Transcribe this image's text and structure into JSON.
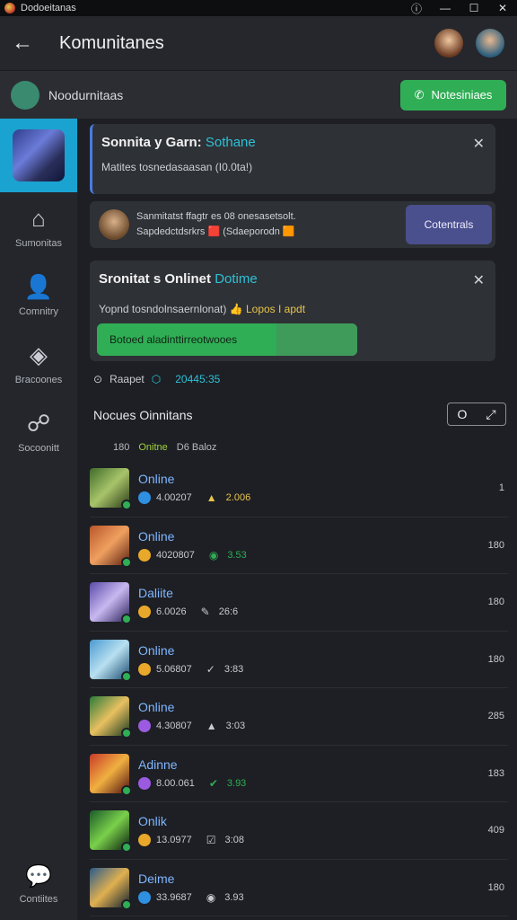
{
  "window": {
    "title": "Dodoeitanas"
  },
  "header": {
    "title": "Komunitanes"
  },
  "subheader": {
    "label": "Noodurnitaas",
    "notify_label": "Notesiniaes"
  },
  "sidebar": {
    "items": [
      {
        "label": "Sumonitas",
        "icon": "home-icon"
      },
      {
        "label": "Comnitry",
        "icon": "user-add-icon"
      },
      {
        "label": "Bracoones",
        "icon": "controller-icon"
      },
      {
        "label": "Socoonitt",
        "icon": "group-icon"
      }
    ],
    "bottom_label": "Contiites"
  },
  "cards": {
    "card1": {
      "title": "Sonnita y Garn:",
      "title_accent": "Sothane",
      "subtitle": "Matites tosnedasaasan (I0.0ta!)"
    },
    "card2": {
      "line1": "Sanmitatst ffagtr es 08 onesasetsolt.",
      "line2": "Sapdedctdsrkrs 🟥 (Sdaeporodn 🟧",
      "button": "Cotentrals"
    },
    "card3": {
      "title": "Sronitat s Onlinet",
      "title_accent": "Dotime",
      "subtitle": "Yopnd tosndolnsaernlonat) 👍",
      "subtitle_hl": "Lopos I apdt",
      "bar_label": "Botoed aladinttirreotwooes"
    }
  },
  "stats": {
    "label": "Raapet",
    "count": "20445:35"
  },
  "section": {
    "title": "Nocues Oinnitans",
    "toggle_left": "O",
    "toggle_right": "⤢"
  },
  "filters": {
    "a": "180",
    "b": "Onitne",
    "c": "D6 Baloz"
  },
  "list": [
    {
      "status": "Online",
      "code": "4.00207",
      "score": "2.006",
      "right": "1",
      "badge": "#2f8fe0",
      "score_icon": "▲",
      "score_color": "#e8c44a"
    },
    {
      "status": "Online",
      "code": "4020807",
      "score": "3.53",
      "right": "180",
      "badge": "#e8a82a",
      "score_icon": "◉",
      "score_color": "#2fae55"
    },
    {
      "status": "Daliite",
      "code": "6.0026",
      "score": "26:6",
      "right": "180",
      "badge": "#e8a82a",
      "score_icon": "✎",
      "score_color": "#c7cad0"
    },
    {
      "status": "Online",
      "code": "5.06807",
      "score": "3:83",
      "right": "180",
      "badge": "#e8a82a",
      "score_icon": "✓",
      "score_color": "#c7cad0"
    },
    {
      "status": "Online",
      "code": "4.30807",
      "score": "3:03",
      "right": "285",
      "badge": "#9a5be0",
      "score_icon": "▲",
      "score_color": "#c7cad0"
    },
    {
      "status": "Adinne",
      "code": "8.00.061",
      "score": "3.93",
      "right": "183",
      "badge": "#9a5be0",
      "score_icon": "✔",
      "score_color": "#2fae55"
    },
    {
      "status": "Onlik",
      "code": "13.0977",
      "score": "3:08",
      "right": "409",
      "badge": "#e8a82a",
      "score_icon": "☑",
      "score_color": "#c7cad0"
    },
    {
      "status": "Deime",
      "code": "33.9687",
      "score": "3.93",
      "right": "180",
      "badge": "#2f8fe0",
      "score_icon": "◉",
      "score_color": "#c7cad0"
    }
  ]
}
